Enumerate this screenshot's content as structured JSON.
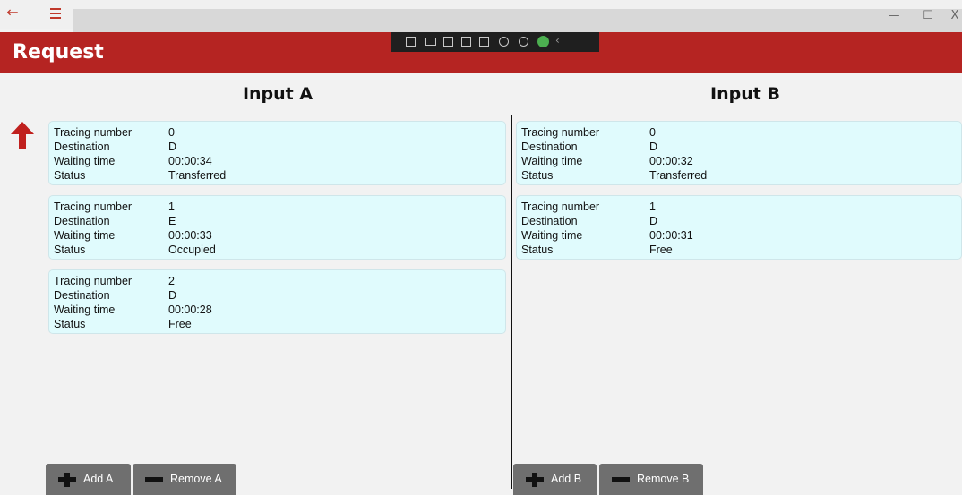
{
  "window": {
    "back_icon": "back-arrow-icon",
    "menu_icon": "hamburger-icon",
    "minimize": "—",
    "maximize": "☐",
    "close": "X"
  },
  "header": {
    "title": "Request",
    "color": "#b52422"
  },
  "inputs": [
    {
      "title": "Input A",
      "cards": [
        {
          "labels": [
            "Tracing number",
            "Destination",
            "Waiting time",
            "Status"
          ],
          "values": [
            "0",
            "D",
            "00:00:34",
            "Transferred"
          ]
        },
        {
          "labels": [
            "Tracing number",
            "Destination",
            "Waiting time",
            "Status"
          ],
          "values": [
            "1",
            "E",
            "00:00:33",
            "Occupied"
          ]
        },
        {
          "labels": [
            "Tracing number",
            "Destination",
            "Waiting time",
            "Status"
          ],
          "values": [
            "2",
            "D",
            "00:00:28",
            "Free"
          ]
        }
      ],
      "add_label": "Add A",
      "remove_label": "Remove A"
    },
    {
      "title": "Input B",
      "cards": [
        {
          "labels": [
            "Tracing number",
            "Destination",
            "Waiting time",
            "Status"
          ],
          "values": [
            "0",
            "D",
            "00:00:32",
            "Transferred"
          ]
        },
        {
          "labels": [
            "Tracing number",
            "Destination",
            "Waiting time",
            "Status"
          ],
          "values": [
            "1",
            "D",
            "00:00:31",
            "Free"
          ]
        }
      ],
      "add_label": "Add B",
      "remove_label": "Remove B"
    }
  ],
  "colors": {
    "card_bg": "#e0fbfd",
    "button_bg": "#6f6f6f",
    "arrow": "#c0201e"
  }
}
